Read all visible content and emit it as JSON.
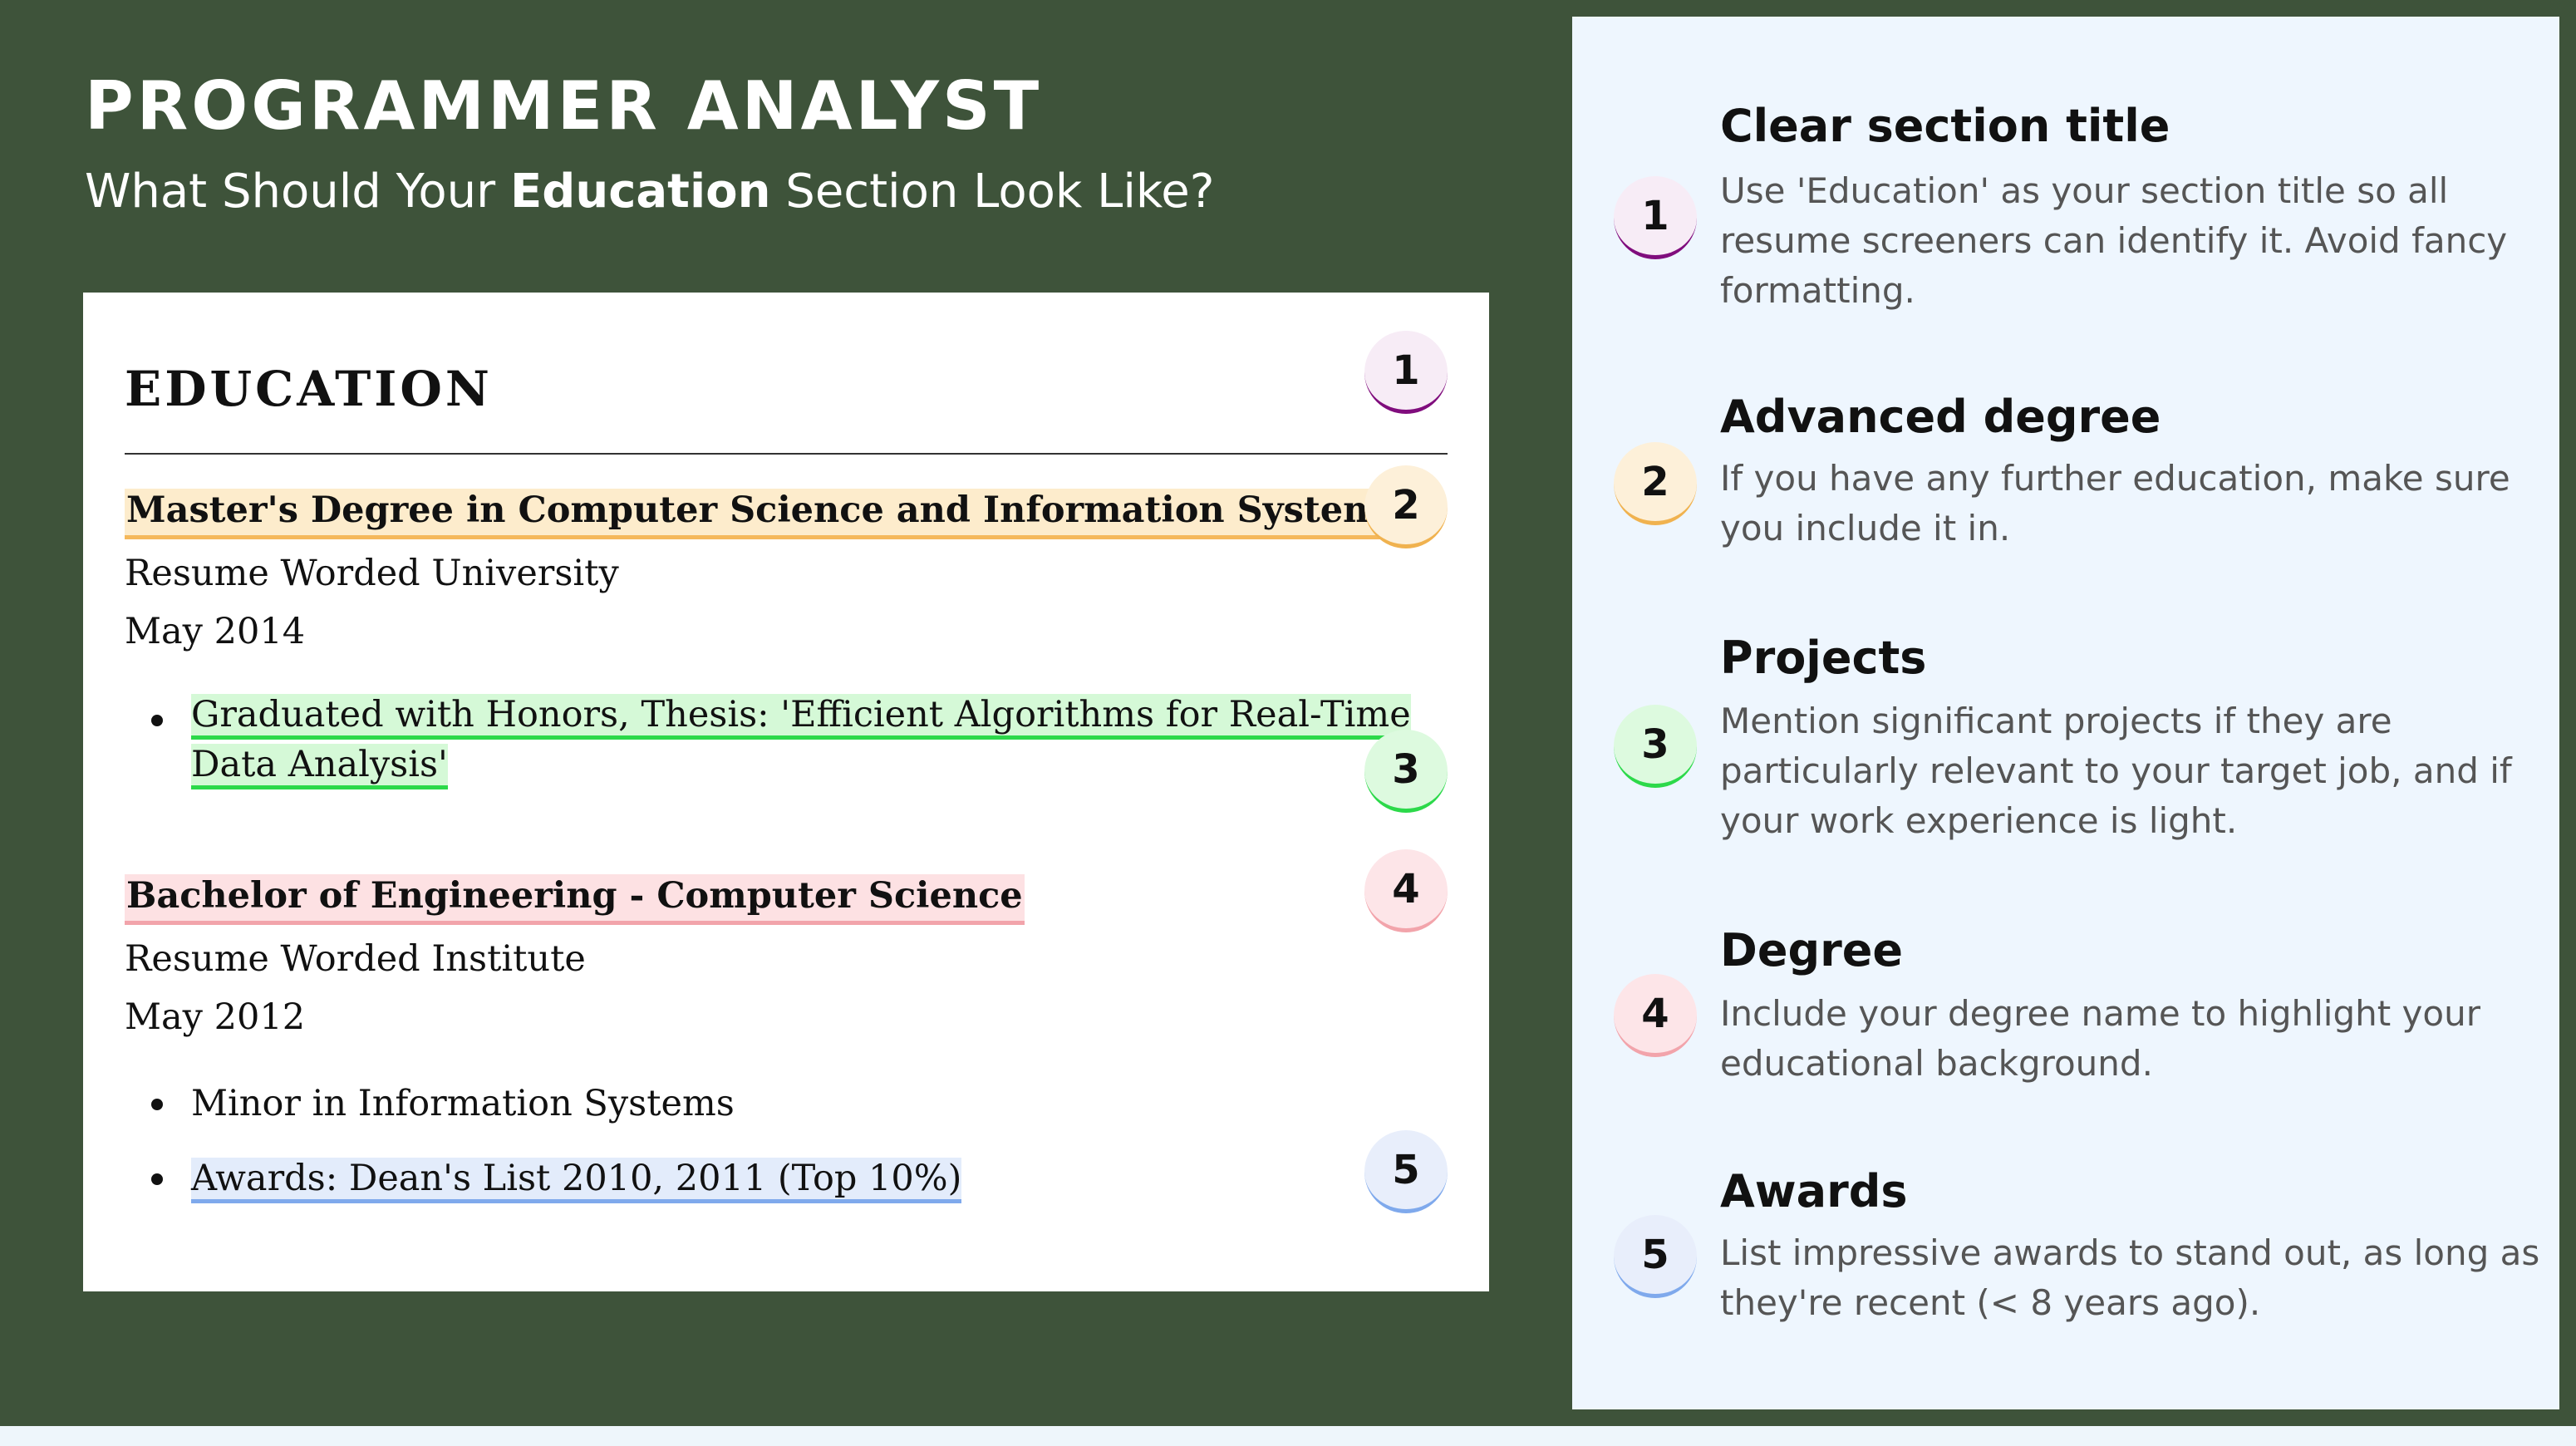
{
  "header": {
    "title": "PROGRAMMER ANALYST",
    "subtitle_prefix": "What Should Your ",
    "subtitle_bold": "Education",
    "subtitle_suffix": " Section Look Like?"
  },
  "resume": {
    "section_heading": "EDUCATION",
    "entries": [
      {
        "degree": "Master's Degree in Computer Science and Information Systems",
        "institution": "Resume Worded University",
        "date": "May 2014",
        "bullets": [
          "Graduated with Honors, Thesis: 'Efficient Algorithms for Real-Time Data Analysis'"
        ]
      },
      {
        "degree": "Bachelor of Engineering - Computer Science",
        "institution": "Resume Worded Institute",
        "date": "May 2012",
        "bullets": [
          "Minor in Information Systems",
          "Awards: Dean's List 2010, 2011 (Top 10%)"
        ]
      }
    ],
    "markers": [
      "1",
      "2",
      "3",
      "4",
      "5"
    ]
  },
  "tips": [
    {
      "number": "1",
      "title": "Clear section title",
      "text": "Use 'Education' as your section title so all resume screeners can identify it. Avoid fancy formatting.",
      "color": "#800d7d"
    },
    {
      "number": "2",
      "title": "Advanced degree",
      "text": "If you have any further education, make sure you include it in.",
      "color": "#f0b24f"
    },
    {
      "number": "3",
      "title": "Projects",
      "text": "Mention significant projects if they are particularly relevant to your target job, and if your work experience is light.",
      "color": "#2cd94a"
    },
    {
      "number": "4",
      "title": "Degree",
      "text": "Include your degree name to highlight your educational background.",
      "color": "#f2a4ab"
    },
    {
      "number": "5",
      "title": "Awards",
      "text": "List impressive awards to stand out, as long as they're recent (< 8 years ago).",
      "color": "#7fa9ec"
    }
  ],
  "colors": {
    "background": "#3e533a",
    "panel": "#eef6fe",
    "card": "#ffffff"
  }
}
